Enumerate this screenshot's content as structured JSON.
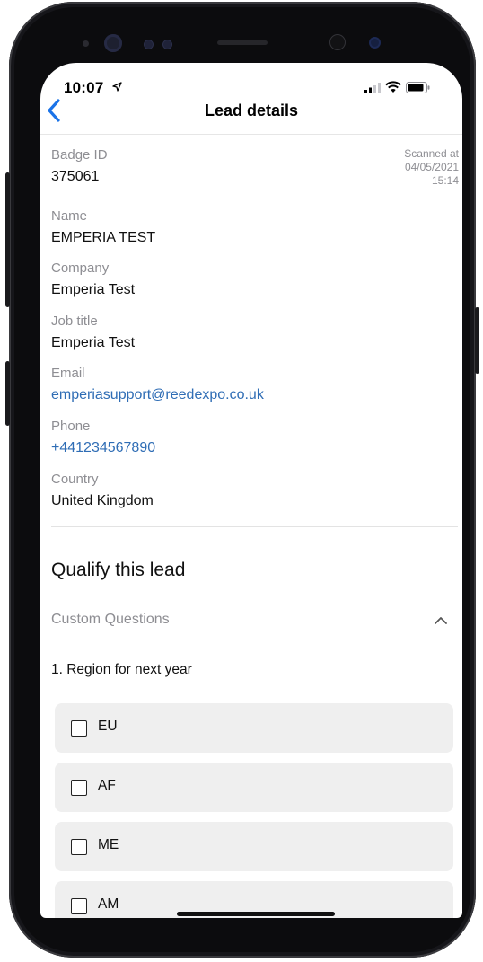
{
  "status_bar": {
    "time": "10:07"
  },
  "nav": {
    "title": "Lead details"
  },
  "lead": {
    "badge_label": "Badge ID",
    "badge_value": "375061",
    "scanned_label": "Scanned at",
    "scanned_date": "04/05/2021",
    "scanned_time": "15:14",
    "name_label": "Name",
    "name_value": "EMPERIA TEST",
    "company_label": "Company",
    "company_value": "Emperia Test",
    "job_label": "Job title",
    "job_value": "Emperia Test",
    "email_label": "Email",
    "email_value": "emperiasupport@reedexpo.co.uk",
    "phone_label": "Phone",
    "phone_value": "+441234567890",
    "country_label": "Country",
    "country_value": "United Kingdom"
  },
  "qualify": {
    "heading": "Qualify this lead",
    "section": "Custom Questions",
    "question": "1. Region for next year",
    "options": [
      "EU",
      "AF",
      "ME",
      "AM"
    ]
  },
  "colors": {
    "accent": "#1a73e8",
    "link": "#2f6db5",
    "label": "#8e8e93",
    "option_bg": "#efefef"
  },
  "icons": [
    "back-chevron-icon",
    "location-arrow-icon",
    "signal-icon",
    "wifi-icon",
    "battery-icon",
    "chevron-up-icon",
    "checkbox-icon"
  ]
}
